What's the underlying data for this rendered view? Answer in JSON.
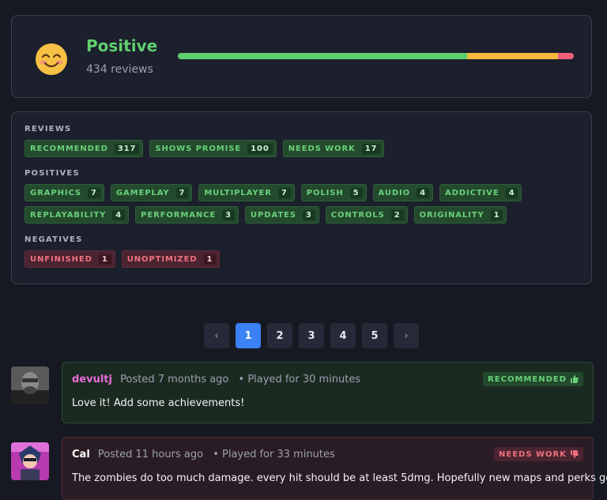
{
  "summary": {
    "sentiment": "Positive",
    "review_count": "434 reviews",
    "distribution": [
      {
        "label": "recommended",
        "value": 317,
        "color": "#5fd06e"
      },
      {
        "label": "shows promise",
        "value": 100,
        "color": "#f5b83d"
      },
      {
        "label": "needs work",
        "value": 17,
        "color": "#f0607a"
      }
    ]
  },
  "tags": {
    "reviews_title": "REVIEWS",
    "reviews": [
      {
        "label": "RECOMMENDED",
        "count": "317"
      },
      {
        "label": "SHOWS PROMISE",
        "count": "100"
      },
      {
        "label": "NEEDS WORK",
        "count": "17"
      }
    ],
    "positives_title": "POSITIVES",
    "positives": [
      {
        "label": "GRAPHICS",
        "count": "7"
      },
      {
        "label": "GAMEPLAY",
        "count": "7"
      },
      {
        "label": "MULTIPLAYER",
        "count": "7"
      },
      {
        "label": "POLISH",
        "count": "5"
      },
      {
        "label": "AUDIO",
        "count": "4"
      },
      {
        "label": "ADDICTIVE",
        "count": "4"
      },
      {
        "label": "REPLAYABILITY",
        "count": "4"
      },
      {
        "label": "PERFORMANCE",
        "count": "3"
      },
      {
        "label": "UPDATES",
        "count": "3"
      },
      {
        "label": "CONTROLS",
        "count": "2"
      },
      {
        "label": "ORIGINALITY",
        "count": "1"
      }
    ],
    "negatives_title": "NEGATIVES",
    "negatives": [
      {
        "label": "UNFINISHED",
        "count": "1"
      },
      {
        "label": "UNOPTIMIZED",
        "count": "1"
      }
    ]
  },
  "pagination": {
    "prev": "‹",
    "pages": [
      "1",
      "2",
      "3",
      "4",
      "5"
    ],
    "active": "1",
    "next": "›"
  },
  "reviews": [
    {
      "user": "devultj",
      "posted": "Posted 7 months ago",
      "played": "• Played for 30 minutes",
      "badge": "RECOMMENDED",
      "text": "Love it! Add some achievements!"
    },
    {
      "user": "Cal",
      "posted": "Posted 11 hours ago",
      "played": "• Played for 33 minutes",
      "badge": "NEEDS WORK",
      "text": "The zombies do too much damage. every hit should be at least 5dmg. Hopefully new maps and perks get"
    }
  ]
}
